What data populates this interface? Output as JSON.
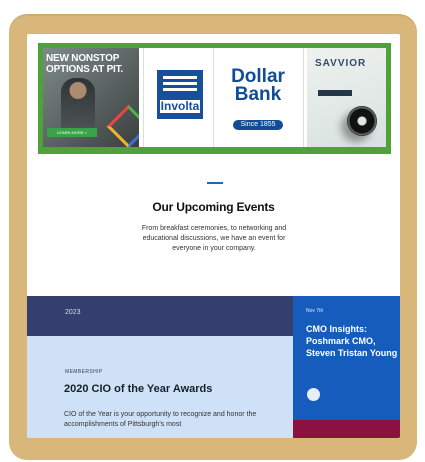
{
  "sponsors": {
    "pit": {
      "headline": "NEW NONSTOP OPTIONS AT PIT.",
      "button": "LEARN MORE >"
    },
    "involta": {
      "name": "Involta"
    },
    "dollar_bank": {
      "name": "Dollar Bank",
      "since": "Since 1855"
    },
    "savvior": {
      "name": "SAVVIOR"
    }
  },
  "events": {
    "title": "Our Upcoming Events",
    "intro": "From breakfast ceremonies, to networking and educational discussions, we have an event for everyone in your company."
  },
  "featured": {
    "tab_label": "2023",
    "event_label": "MEMBERSHIP",
    "event_title": "2020 CIO of the Year Awards",
    "event_description": "CIO of the Year is your opportunity to recognize and honor the accomplishments of Pittsburgh's most"
  },
  "sidebar": {
    "label": "Nov 7th",
    "title": "CMO Insights: Poshmark CMO, Steven Tristan Young"
  }
}
